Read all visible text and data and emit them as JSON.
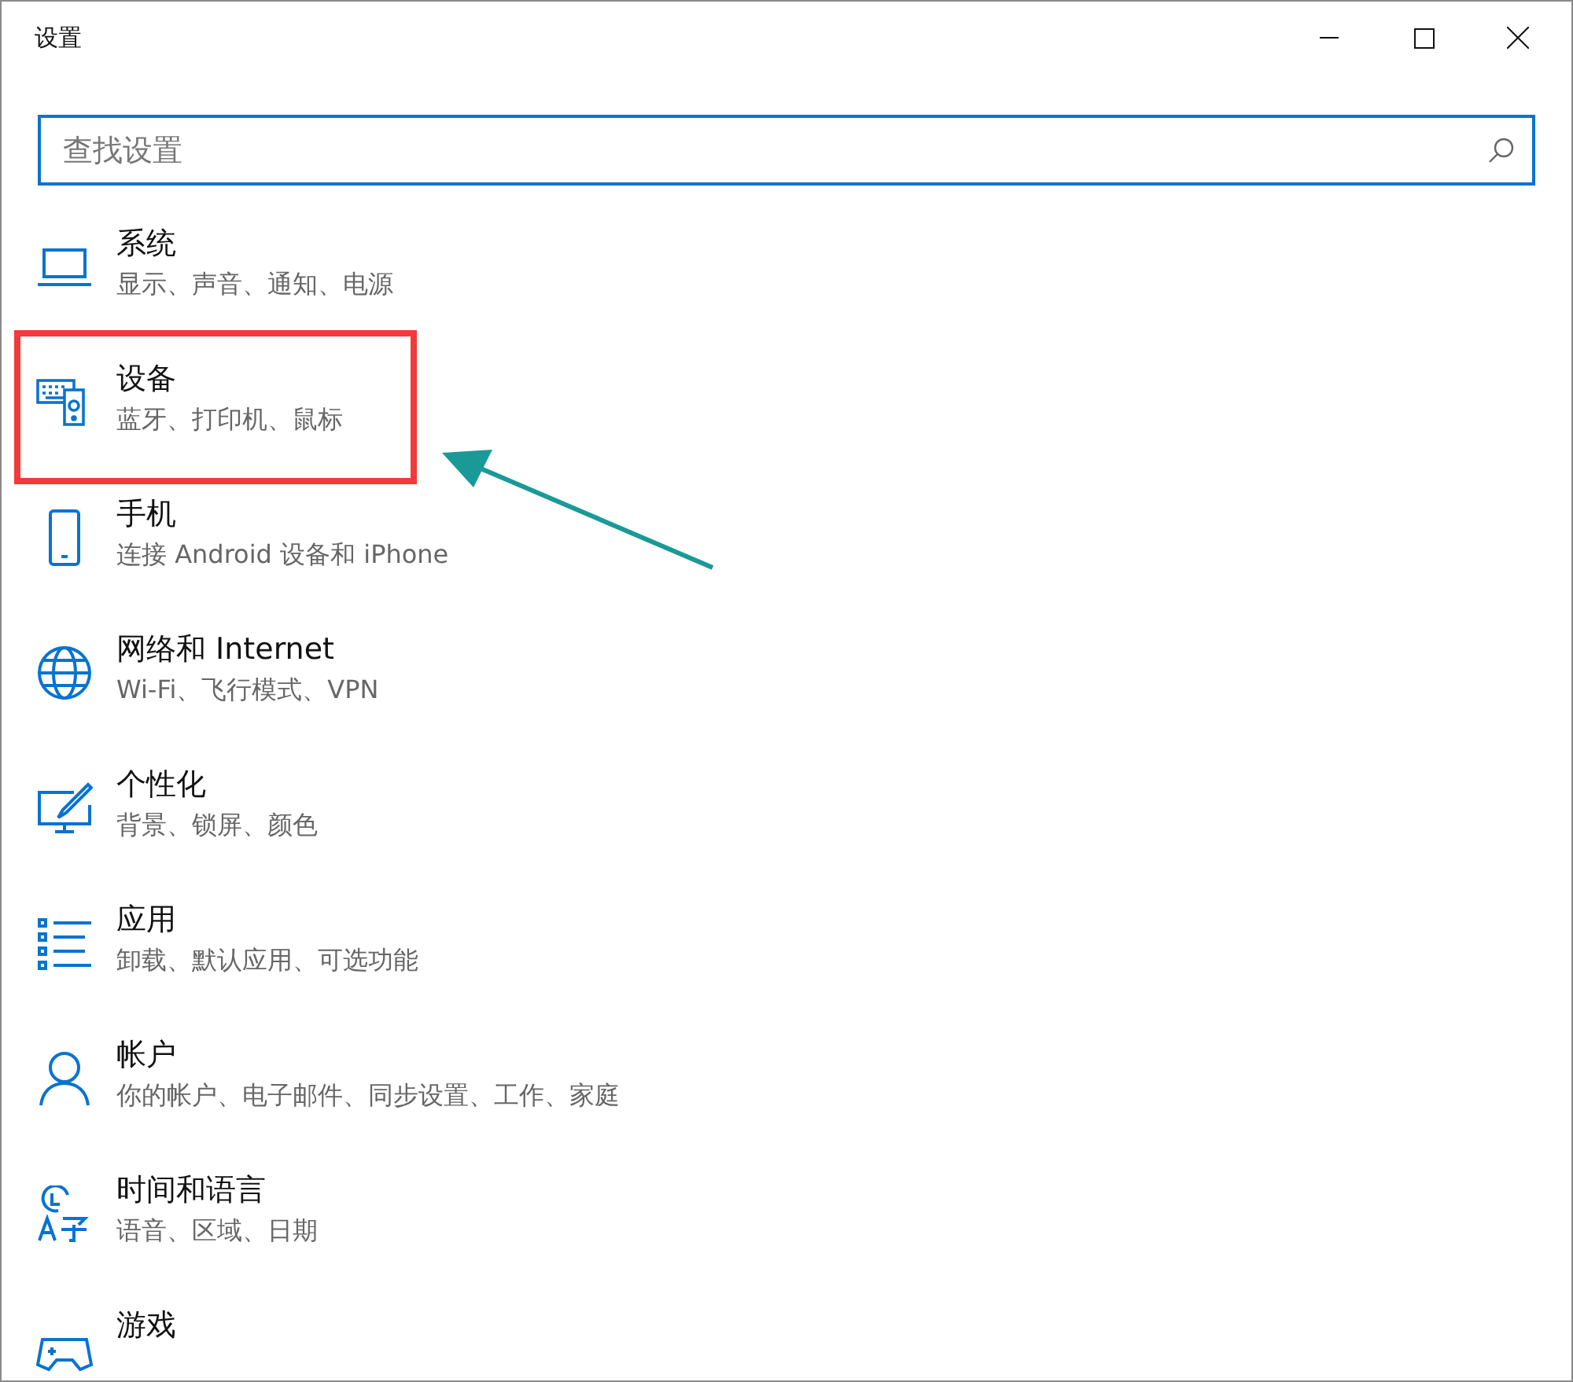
{
  "window": {
    "title": "设置"
  },
  "search": {
    "placeholder": "查找设置"
  },
  "items": [
    {
      "kind": "system",
      "title": "系统",
      "subtitle": "显示、声音、通知、电源",
      "highlighted": false
    },
    {
      "kind": "devices",
      "title": "设备",
      "subtitle": "蓝牙、打印机、鼠标",
      "highlighted": true
    },
    {
      "kind": "phone",
      "title": "手机",
      "subtitle": "连接 Android 设备和 iPhone",
      "highlighted": false
    },
    {
      "kind": "network",
      "title": "网络和 Internet",
      "subtitle": "Wi-Fi、飞行模式、VPN",
      "highlighted": false
    },
    {
      "kind": "personalization",
      "title": "个性化",
      "subtitle": "背景、锁屏、颜色",
      "highlighted": false
    },
    {
      "kind": "apps",
      "title": "应用",
      "subtitle": "卸载、默认应用、可选功能",
      "highlighted": false
    },
    {
      "kind": "accounts",
      "title": "帐户",
      "subtitle": "你的帐户、电子邮件、同步设置、工作、家庭",
      "highlighted": false
    },
    {
      "kind": "time",
      "title": "时间和语言",
      "subtitle": "语音、区域、日期",
      "highlighted": false
    },
    {
      "kind": "gaming",
      "title": "游戏",
      "highlighted": false
    }
  ]
}
